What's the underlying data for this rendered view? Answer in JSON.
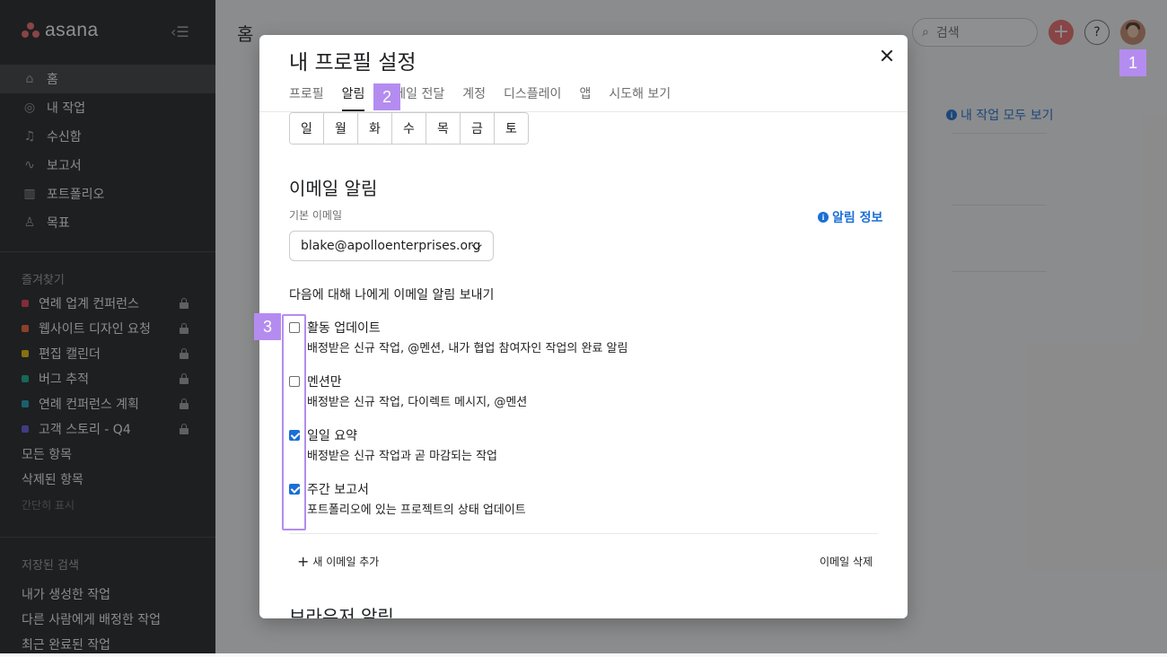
{
  "sidebar": {
    "logo": "asana",
    "nav": [
      {
        "label": "홈",
        "icon": "home-icon"
      },
      {
        "label": "내 작업",
        "icon": "check-circle-icon"
      },
      {
        "label": "수신함",
        "icon": "bell-icon"
      },
      {
        "label": "보고서",
        "icon": "chart-line-icon"
      },
      {
        "label": "포트폴리오",
        "icon": "portfolio-icon"
      },
      {
        "label": "목표",
        "icon": "person-icon"
      }
    ],
    "favorites_title": "즐겨찾기",
    "favorites": [
      {
        "label": "연례 업계 컨퍼런스",
        "color": "#e8384f"
      },
      {
        "label": "웹사이트 디자인 요청",
        "color": "#fd612c"
      },
      {
        "label": "편집 캘린더",
        "color": "#eec300"
      },
      {
        "label": "버그 추적",
        "color": "#0fb08c"
      },
      {
        "label": "연례 컨퍼런스 계획",
        "color": "#17a2b8"
      },
      {
        "label": "고객 스토리 - Q4",
        "color": "#6457e2"
      }
    ],
    "all_items": "모든 항목",
    "deleted_items": "삭제된 항목",
    "show_less": "간단히 표시",
    "saved_search_title": "저장된 검색",
    "saved_searches": [
      "내가 생성한 작업",
      "다른 사람에게 배정한 작업",
      "최근 완료된 작업"
    ]
  },
  "main": {
    "title": "홈",
    "search_placeholder": "검색",
    "view_all": "내 작업 모두 보기"
  },
  "modal": {
    "title": "내 프로필 설정",
    "tabs": [
      "프로필",
      "알림",
      "이메일 전달",
      "계정",
      "디스플레이",
      "앱",
      "시도해 보기"
    ],
    "active_tab": "알림",
    "days": [
      "일",
      "월",
      "화",
      "수",
      "목",
      "금",
      "토"
    ],
    "email_section": "이메일 알림",
    "default_email_label": "기본 이메일",
    "notif_info": "알림 정보",
    "email_value": "blake@apolloenterprises.org",
    "send_label": "다음에 대해 나에게 이메일 알림 보내기",
    "options": [
      {
        "title": "활동 업데이트",
        "desc": "배정받은 신규 작업, @멘션, 내가 협업 참여자인 작업의 완료 알림",
        "checked": false
      },
      {
        "title": "멘션만",
        "desc": "배정받은 신규 작업, 다이렉트 메시지, @멘션",
        "checked": false
      },
      {
        "title": "일일 요약",
        "desc": "배정받은 신규 작업과 곧 마감되는 작업",
        "checked": true
      },
      {
        "title": "주간 보고서",
        "desc": "포트폴리오에 있는 프로젝트의 상태 업데이트",
        "checked": true
      }
    ],
    "add_email": "새 이메일 추가",
    "delete_email": "이메일 삭제",
    "browser_section": "브라우저 알림"
  },
  "annotations": [
    "1",
    "2",
    "3"
  ]
}
